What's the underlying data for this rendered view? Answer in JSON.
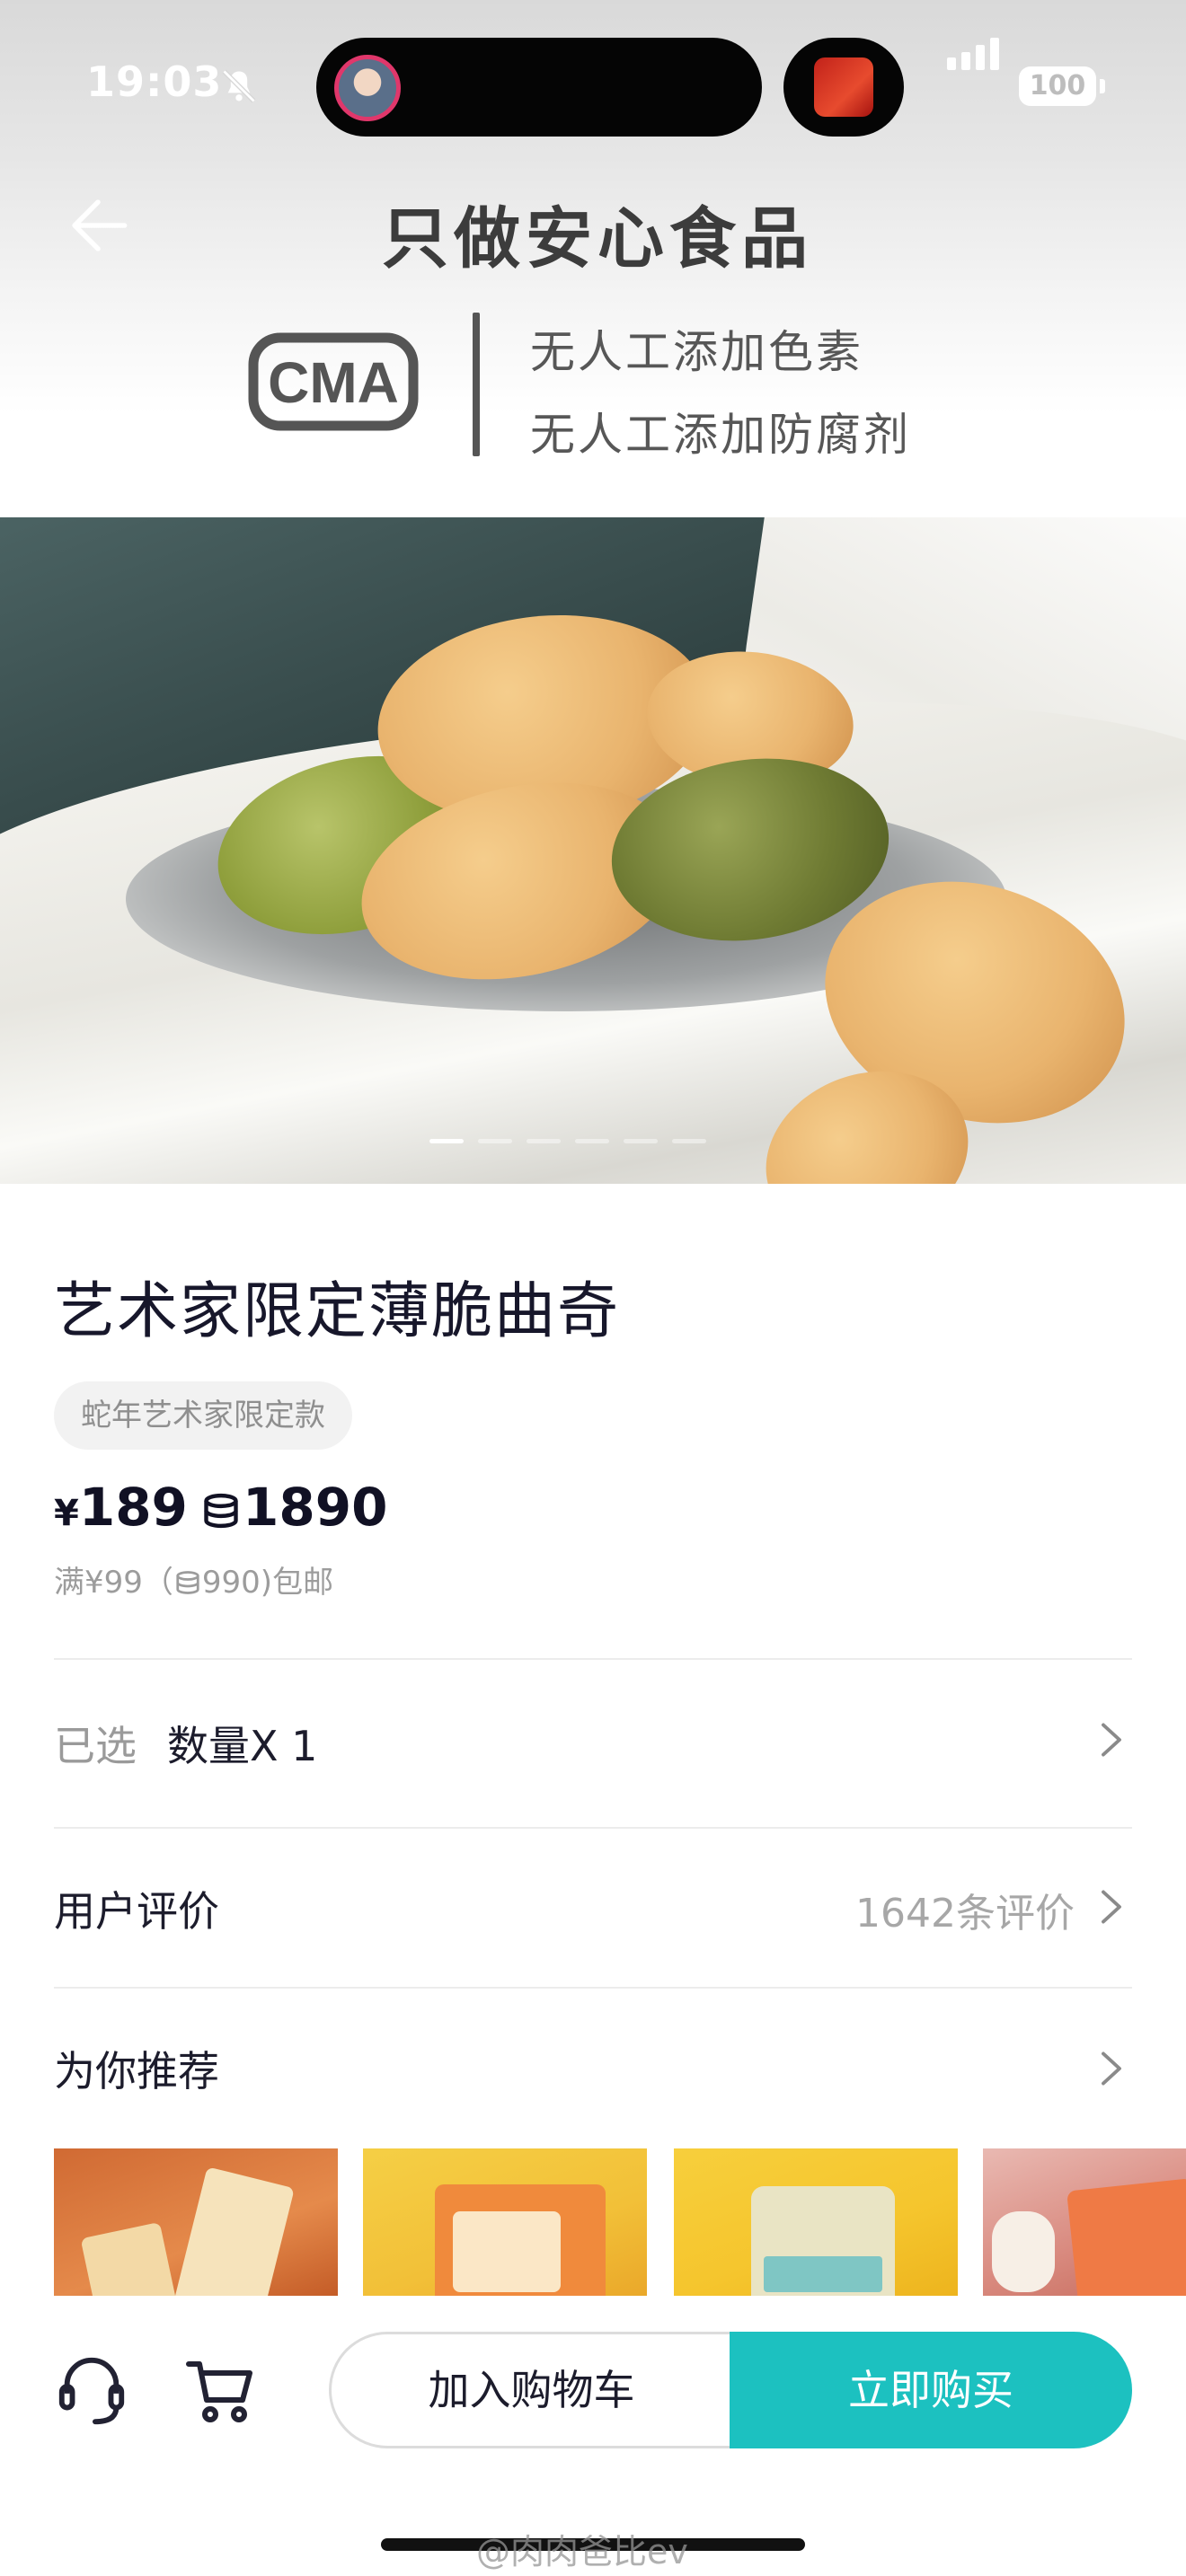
{
  "status_bar": {
    "time": "19:03",
    "battery": "100"
  },
  "banner": {
    "title": "只做安心食品",
    "cert_logo_text": "CMA",
    "claims": [
      "无人工添加色素",
      "无人工添加防腐剂"
    ]
  },
  "carousel": {
    "total": 6,
    "active_index": 0
  },
  "product": {
    "title": "艺术家限定薄脆曲奇",
    "tag": "蛇年艺术家限定款",
    "price_symbol": "¥",
    "price": "189",
    "coin_price": "1890",
    "shipping_prefix": "满¥99（",
    "shipping_coin_value": "990)包邮"
  },
  "rows": {
    "selected_label": "已选",
    "selected_value": "数量X 1",
    "reviews_label": "用户评价",
    "reviews_count": "1642条评价",
    "recommend_label": "为你推荐"
  },
  "bottom_bar": {
    "add_to_cart": "加入购物车",
    "buy_now": "立即购买"
  },
  "watermark": "@肉肉爸比ev",
  "colors": {
    "accent": "#1cc1c0",
    "text_primary": "#1c1c2c",
    "text_muted": "#9a9a9a"
  },
  "icons": [
    "bell-slash-icon",
    "signal-icon",
    "battery-icon",
    "back-arrow-icon",
    "cma-logo",
    "coin-icon",
    "chevron-right-icon",
    "customer-service-icon",
    "cart-icon"
  ]
}
